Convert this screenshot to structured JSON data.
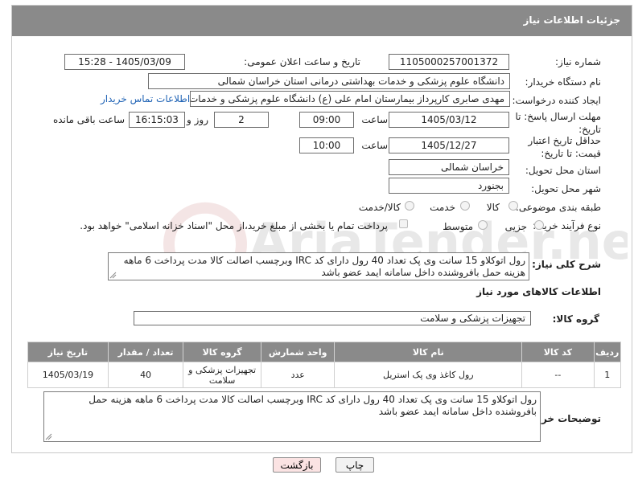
{
  "title": "جزئیات اطلاعات نیاز",
  "fields": {
    "need_number_label": "شماره نیاز:",
    "need_number": "1105000257001372",
    "announce_label": "تاریخ و ساعت اعلان عمومی:",
    "announce_value": "1405/03/09 - 15:28",
    "buyer_org_label": "نام دستگاه خریدار:",
    "buyer_org": "دانشگاه علوم پزشکی و خدمات بهداشتی درمانی استان خراسان شمالی",
    "requester_label": "ایجاد کننده درخواست:",
    "requester": "مهدی صابری کارپرداز بیمارستان امام علی (ع) دانشگاه علوم پزشکی و خدمات بهداشتی",
    "contact_link": "اطلاعات تماس خریدار",
    "reply_deadline_label": "مهلت ارسال پاسخ: تا تاریخ:",
    "reply_date": "1405/03/12",
    "time_label": "ساعت",
    "reply_time": "09:00",
    "days_value": "2",
    "days_label": "روز و",
    "remaining_time": "16:15:03",
    "remaining_label": "ساعت باقی مانده",
    "price_validity_label": "حداقل تاریخ اعتبار قیمت: تا تاریخ:",
    "price_date": "1405/12/27",
    "price_time_label": "ساعت",
    "price_time": "10:00",
    "province_label": "استان محل تحویل:",
    "province": "خراسان شمالی",
    "city_label": "شهر محل تحویل:",
    "city": "بجنورد",
    "category_label": "طبقه بندی موضوعی:",
    "category_options": [
      "کالا",
      "خدمت",
      "کالا/خدمت"
    ],
    "process_label": "نوع فرآیند خرید :",
    "process_options": [
      "جزیی",
      "متوسط"
    ],
    "payment_note": "پرداخت تمام یا بخشی از مبلغ خرید،از محل \"اسناد خزانه اسلامی\" خواهد بود."
  },
  "general_desc": {
    "label": "شرح کلی نیاز:",
    "text": "رول اتوکلاو 15 سانت وی پک تعداد 40 رول دارای کد IRC وبرچسب اصالت  کالا مدت پرداخت 6 ماهه هزینه حمل بافروشنده داخل سامانه ایمد عضو باشد"
  },
  "goods_section": {
    "title": "اطلاعات کالاهای مورد نیاز",
    "group_label": "گروه کالا:",
    "group_value": "تجهیزات پزشکی و سلامت"
  },
  "table": {
    "headers": [
      "ردیف",
      "کد کالا",
      "نام کالا",
      "واحد شمارش",
      "گروه کالا",
      "تعداد / مقدار",
      "تاریخ نیاز"
    ],
    "rows": [
      [
        "1",
        "--",
        "رول کاغذ وی پک استریل",
        "عدد",
        "تجهیزات پزشکی و سلامت",
        "40",
        "1405/03/19"
      ]
    ]
  },
  "buyer_notes": {
    "label": "توضیحات خریدار:",
    "text": "رول اتوکلاو 15 سانت وی پک تعداد 40 رول دارای کد IRC وبرچسب اصالت  کالا مدت پرداخت 6 ماهه هزینه حمل بافروشنده داخل سامانه ایمد عضو باشد"
  },
  "buttons": {
    "print": "چاپ",
    "back": "بازگشت"
  },
  "watermark_text": "AriaTender.neT",
  "colors": {
    "header": "#8a8a8a",
    "link": "#1f63b5",
    "back_button": "#fbe3e3",
    "print_button": "#f2f2f2"
  }
}
